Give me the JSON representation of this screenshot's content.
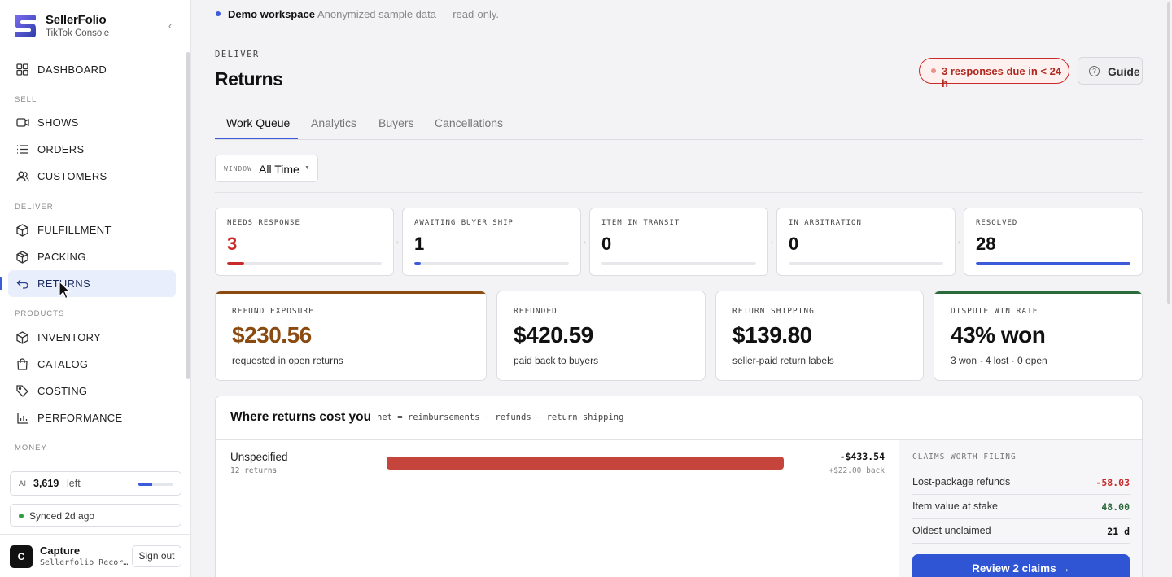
{
  "brand": {
    "name": "SellerFolio",
    "subtitle": "TikTok Console"
  },
  "sidebar": {
    "dashboard": "DASHBOARD",
    "sections": {
      "sell": "SELL",
      "deliver": "DELIVER",
      "products": "PRODUCTS",
      "money": "MONEY"
    },
    "items": {
      "shows": "SHOWS",
      "orders": "ORDERS",
      "customers": "CUSTOMERS",
      "fulfillment": "FULFILLMENT",
      "packing": "PACKING",
      "returns": "RETURNS",
      "inventory": "INVENTORY",
      "catalog": "CATALOG",
      "costing": "COSTING",
      "performance": "PERFORMANCE"
    },
    "active_item": "returns",
    "ai": {
      "tag": "AI",
      "count": "3,619",
      "suffix": "left",
      "usage_fraction": 0.4
    },
    "sync": {
      "text": "Synced 2d ago",
      "color": "#2f9e44"
    },
    "user": {
      "initial": "C",
      "name": "Capture",
      "subtitle": "Sellerfolio Recor…",
      "signout": "Sign out"
    }
  },
  "banner": {
    "title": "Demo workspace",
    "subtitle": "Anonymized sample data — read-only."
  },
  "header": {
    "eyebrow": "DELIVER",
    "title": "Returns",
    "due_badge": "3 responses due in < 24 h",
    "guide": "Guide"
  },
  "tabs": [
    {
      "label": "Work Queue",
      "active": true
    },
    {
      "label": "Analytics",
      "active": false
    },
    {
      "label": "Buyers",
      "active": false
    },
    {
      "label": "Cancellations",
      "active": false
    }
  ],
  "window_filter": {
    "tag": "WINDOW",
    "value": "All Time"
  },
  "pipeline": [
    {
      "label": "NEEDS RESPONSE",
      "value": "3",
      "fraction": 0.11,
      "color": "#c92a2a"
    },
    {
      "label": "AWAITING BUYER SHIP",
      "value": "1",
      "fraction": 0.04,
      "color": "#3b5bdb"
    },
    {
      "label": "ITEM IN TRANSIT",
      "value": "0",
      "fraction": 0,
      "color": "#3b5bdb"
    },
    {
      "label": "IN ARBITRATION",
      "value": "0",
      "fraction": 0,
      "color": "#3b5bdb"
    },
    {
      "label": "RESOLVED",
      "value": "28",
      "fraction": 1.0,
      "color": "#3b5bdb"
    }
  ],
  "money": [
    {
      "label": "REFUND EXPOSURE",
      "value": "$230.56",
      "sub": "requested in open returns",
      "value_color": "#8a4a10",
      "accent": "#8a4a10"
    },
    {
      "label": "REFUNDED",
      "value": "$420.59",
      "sub": "paid back to buyers",
      "value_color": "#111111",
      "accent": ""
    },
    {
      "label": "RETURN SHIPPING",
      "value": "$139.80",
      "sub": "seller-paid return labels",
      "value_color": "#111111",
      "accent": ""
    },
    {
      "label": "DISPUTE WIN RATE",
      "value": "43% won",
      "sub": "3 won · 4 lost · 0 open",
      "value_color": "#111111",
      "accent": "#2b6a3a"
    }
  ],
  "cost": {
    "title": "Where returns cost you",
    "formula": "net = reimbursements − refunds − return shipping",
    "rows": [
      {
        "name": "Unspecified",
        "count": "12 returns",
        "net": "-$433.54",
        "back": "+$22.00 back",
        "bar_fraction": 1.0
      }
    ]
  },
  "claims": {
    "title": "CLAIMS WORTH FILING",
    "rows": [
      {
        "label": "Lost-package refunds",
        "value": "-58.03",
        "color": "#c92a2a"
      },
      {
        "label": "Item value at stake",
        "value": "48.00",
        "color": "#2b6a3a"
      },
      {
        "label": "Oldest unclaimed",
        "value": "21 d",
        "color": "#111111"
      }
    ],
    "button": "Review 2 claims →"
  },
  "colors": {
    "accent": "#3b5bdb",
    "danger": "#c92a2a",
    "success": "#2f9e44"
  }
}
